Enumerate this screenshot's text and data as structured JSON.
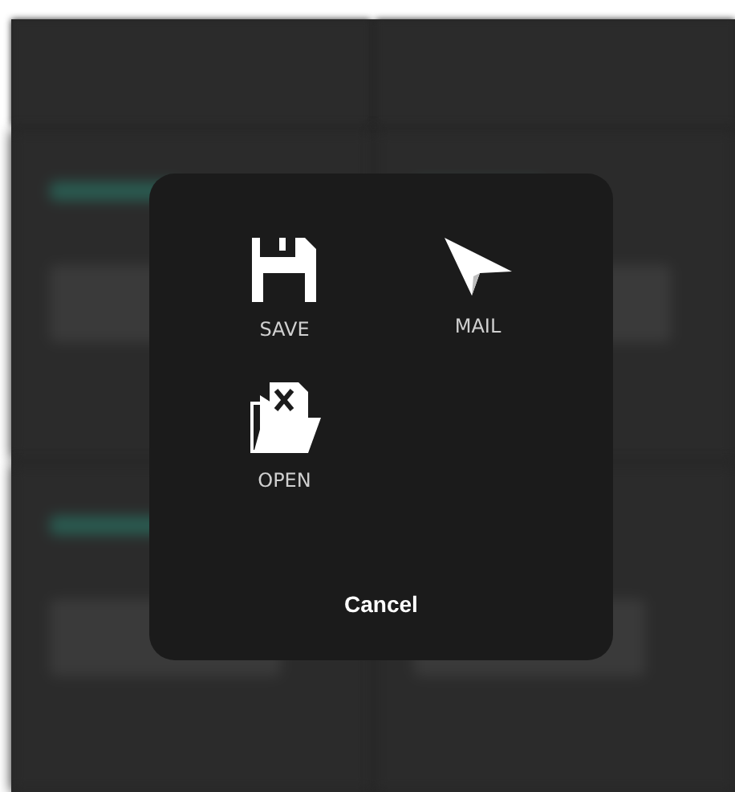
{
  "dialog": {
    "actions": [
      {
        "kind": "save",
        "label": "SAVE"
      },
      {
        "kind": "mail",
        "label": "MAIL"
      },
      {
        "kind": "open",
        "label": "OPEN"
      }
    ],
    "cancel": "Cancel"
  }
}
